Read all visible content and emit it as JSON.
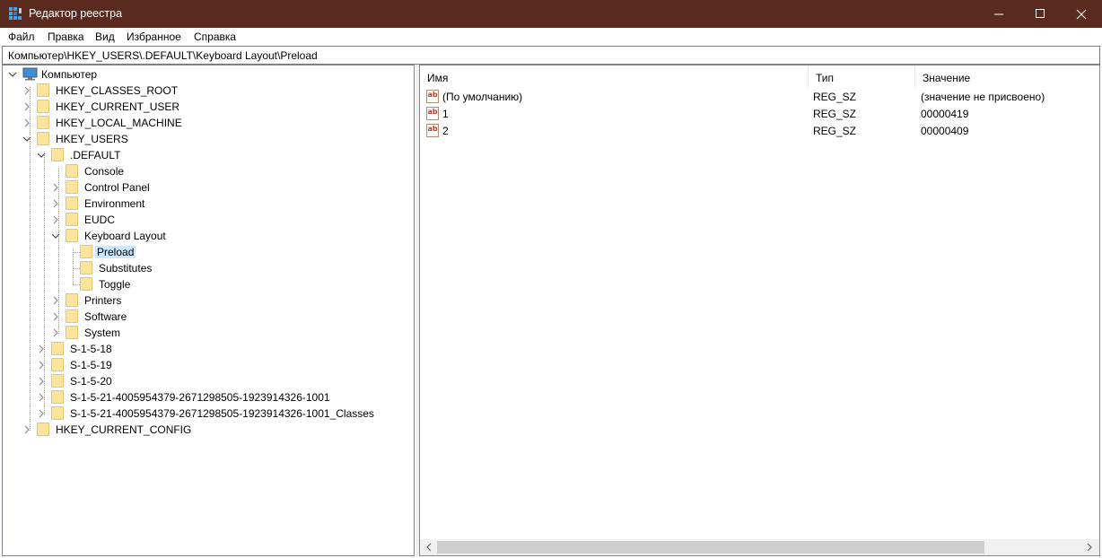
{
  "window": {
    "title": "Редактор реестра",
    "minimize_icon": "minimize-icon",
    "maximize_icon": "maximize-icon",
    "close_icon": "close-icon",
    "title_bar_color": "#5b2a1f"
  },
  "menu": [
    {
      "label": "Файл"
    },
    {
      "label": "Правка"
    },
    {
      "label": "Вид"
    },
    {
      "label": "Избранное"
    },
    {
      "label": "Справка"
    }
  ],
  "address": "Компьютер\\HKEY_USERS\\.DEFAULT\\Keyboard Layout\\Preload",
  "tree": {
    "root": "Компьютер",
    "items": [
      {
        "label": "HKEY_CLASSES_ROOT"
      },
      {
        "label": "HKEY_CURRENT_USER"
      },
      {
        "label": "HKEY_LOCAL_MACHINE"
      },
      {
        "label": "HKEY_USERS"
      },
      {
        "label": ".DEFAULT"
      },
      {
        "label": "Console"
      },
      {
        "label": "Control Panel"
      },
      {
        "label": "Environment"
      },
      {
        "label": "EUDC"
      },
      {
        "label": "Keyboard Layout"
      },
      {
        "label": "Preload"
      },
      {
        "label": "Substitutes"
      },
      {
        "label": "Toggle"
      },
      {
        "label": "Printers"
      },
      {
        "label": "Software"
      },
      {
        "label": "System"
      },
      {
        "label": "S-1-5-18"
      },
      {
        "label": "S-1-5-19"
      },
      {
        "label": "S-1-5-20"
      },
      {
        "label": "S-1-5-21-4005954379-2671298505-1923914326-1001"
      },
      {
        "label": "S-1-5-21-4005954379-2671298505-1923914326-1001_Classes"
      },
      {
        "label": "HKEY_CURRENT_CONFIG"
      }
    ],
    "selected": "Preload"
  },
  "values": {
    "columns": {
      "name": "Имя",
      "type": "Тип",
      "data": "Значение"
    },
    "rows": [
      {
        "name": "(По умолчанию)",
        "type": "REG_SZ",
        "data": "(значение не присвоено)",
        "icon": "string-value-icon"
      },
      {
        "name": "1",
        "type": "REG_SZ",
        "data": "00000419",
        "icon": "string-value-icon"
      },
      {
        "name": "2",
        "type": "REG_SZ",
        "data": "00000409",
        "icon": "string-value-icon"
      }
    ]
  },
  "colors": {
    "selection": "#cce8ff",
    "folder": "#fce49c"
  }
}
